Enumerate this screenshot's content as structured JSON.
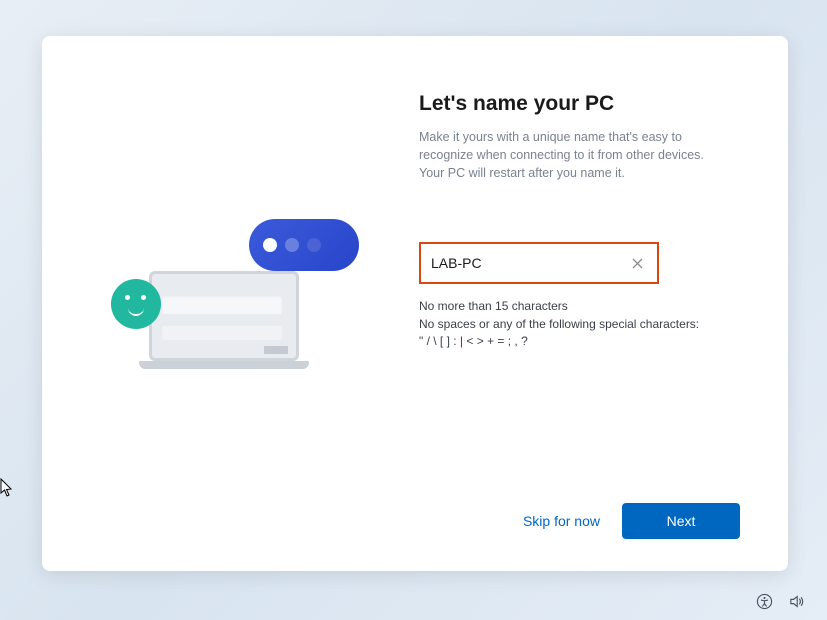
{
  "title": "Let's name your PC",
  "subtitle": "Make it yours with a unique name that's easy to recognize when connecting to it from other devices. Your PC will restart after you name it.",
  "input": {
    "value": "LAB-PC",
    "placeholder": ""
  },
  "hints": {
    "line1": "No more than 15 characters",
    "line2": "No spaces or any of the following special characters:",
    "line3": "\" / \\ [ ] : | < > + = ; , ?"
  },
  "buttons": {
    "skip": "Skip for now",
    "next": "Next"
  },
  "colors": {
    "accent": "#0067c0",
    "highlight_border": "#d9480f"
  }
}
